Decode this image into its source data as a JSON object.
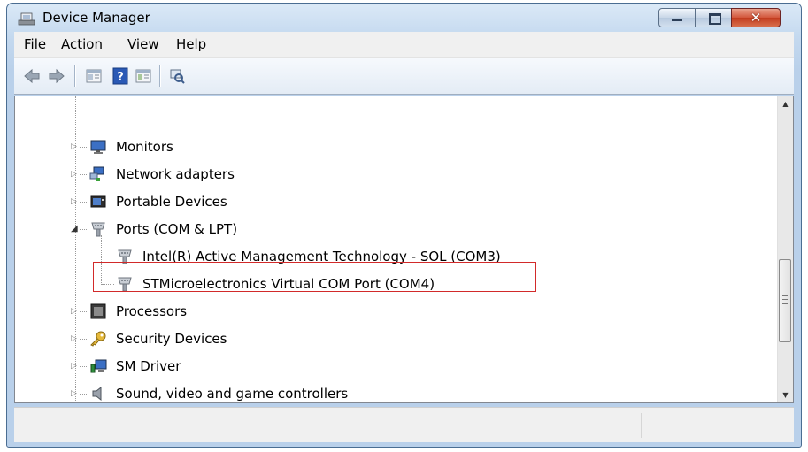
{
  "window": {
    "title": "Device Manager"
  },
  "menu": [
    "File",
    "Action",
    "View",
    "Help"
  ],
  "toolbar": {
    "icons": [
      "back-icon",
      "forward-icon",
      "show-hide-console-tree-icon",
      "help-icon",
      "properties-icon",
      "scan-hardware-icon"
    ]
  },
  "tree": {
    "monitors": "Monitors",
    "network": "Network adapters",
    "portable": "Portable Devices",
    "ports": "Ports (COM & LPT)",
    "intel_sol": "Intel(R) Active Management Technology - SOL (COM3)",
    "st_com": "STMicroelectronics Virtual COM Port (COM4)",
    "processors": "Processors",
    "security": "Security Devices",
    "sm_driver": "SM Driver",
    "sound": "Sound, video and game controllers"
  },
  "highlight_color": "#d22a2a"
}
